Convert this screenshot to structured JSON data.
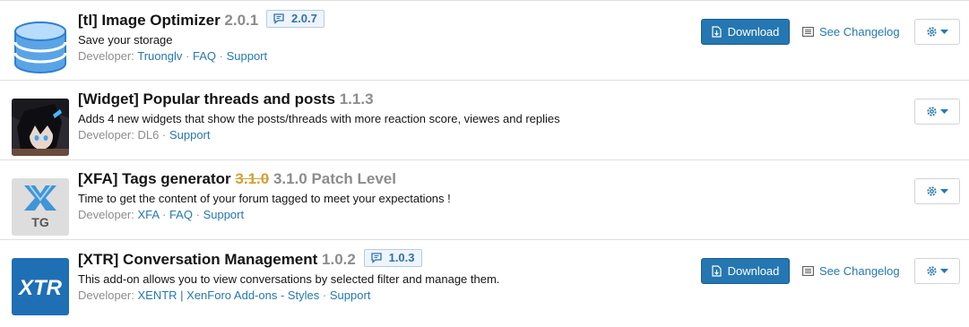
{
  "addons": [
    {
      "title": "[tl] Image Optimizer",
      "version": "2.0.1",
      "update_version": "2.0.7",
      "description": "Save your storage",
      "developer_label": "Developer:",
      "links": [
        "Truonglv",
        "FAQ",
        "Support"
      ],
      "download_label": "Download",
      "changelog_label": "See Changelog"
    },
    {
      "title": "[Widget] Popular threads and posts",
      "version": "1.1.3",
      "description": "Adds 4 new widgets that show the posts/threads with more reaction score, viewes and replies",
      "developer_label": "Developer:",
      "developer_name": "DL6",
      "links": [
        "Support"
      ]
    },
    {
      "title": "[XFA] Tags generator",
      "old_version": "3.1.0",
      "version": "3.1.0 Patch Level",
      "description": "Time to get the content of your forum tagged to meet your expectations !",
      "developer_label": "Developer:",
      "links": [
        "XFA",
        "FAQ",
        "Support"
      ],
      "icon_text": "TG"
    },
    {
      "title": "[XTR] Conversation Management",
      "version": "1.0.2",
      "update_version": "1.0.3",
      "description": "This add-on allows you to view conversations by selected filter and manage them.",
      "developer_label": "Developer:",
      "links": [
        "XENTR | XenForo Add-ons - Styles",
        "Support"
      ],
      "download_label": "Download",
      "changelog_label": "See Changelog",
      "icon_text": "XTR"
    }
  ],
  "separator": "·",
  "colors": {
    "accent": "#2577b1",
    "muted": "#8c8c8c",
    "strike": "#d3a032"
  }
}
